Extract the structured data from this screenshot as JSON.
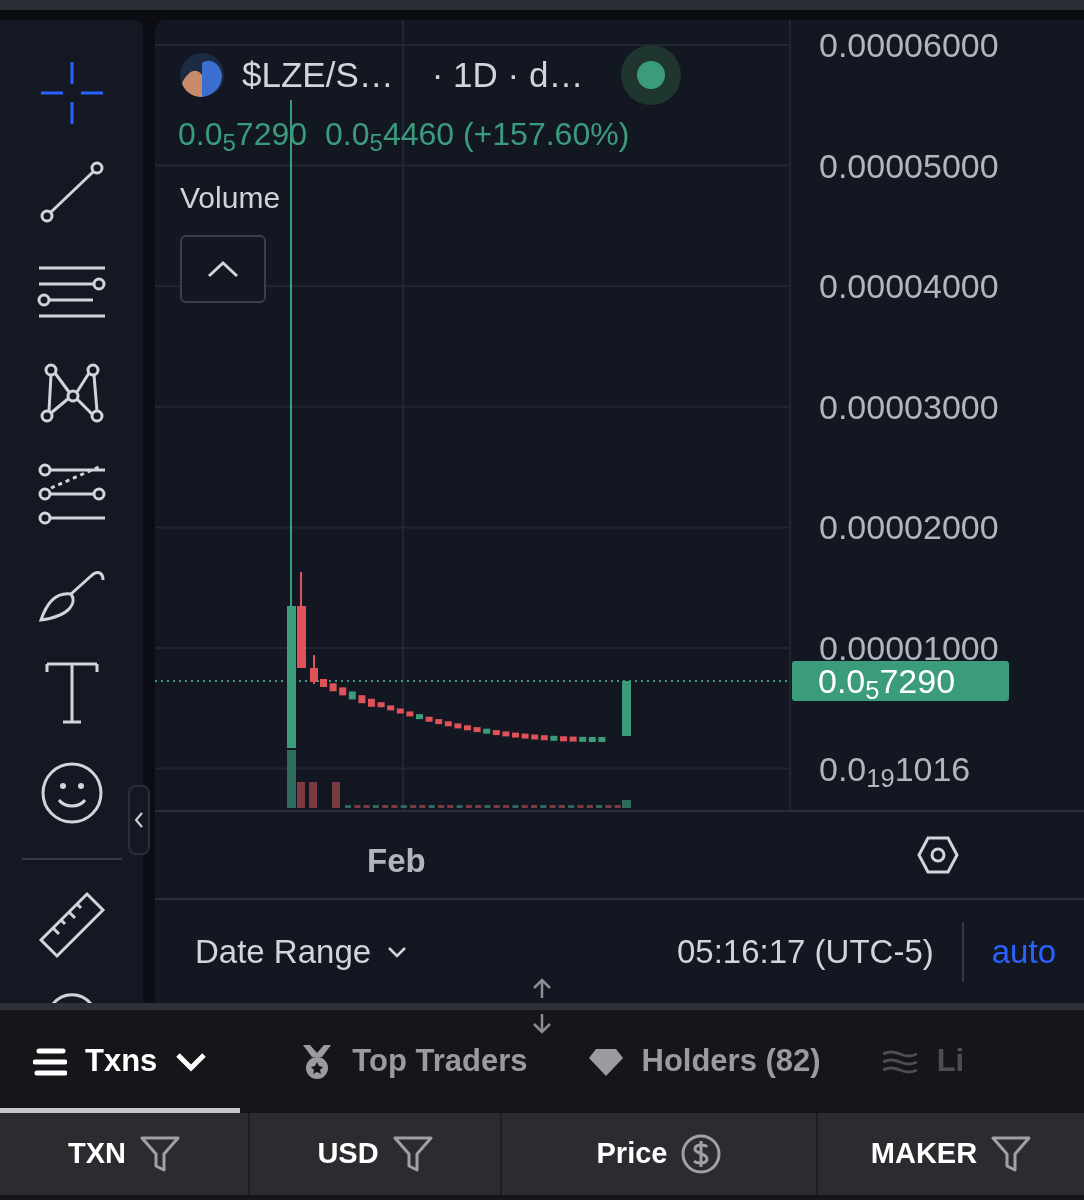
{
  "toolbar": {
    "tools": [
      {
        "kind": "crosshair",
        "selected": true
      },
      {
        "kind": "trend-line",
        "selected": false
      },
      {
        "kind": "parallel-lines",
        "selected": false
      },
      {
        "kind": "pattern",
        "selected": false
      },
      {
        "kind": "fib",
        "selected": false
      },
      {
        "kind": "brush",
        "selected": false
      },
      {
        "kind": "text",
        "selected": false
      },
      {
        "kind": "emoji",
        "selected": false
      },
      {
        "kind": "ruler",
        "selected": false
      },
      {
        "kind": "circle",
        "selected": false
      }
    ]
  },
  "chart": {
    "symbol": "$LZE/S…",
    "interval": "· 1D · d…",
    "last_price": "0.0$_{5}$7290",
    "change": "0.0$_{5}$4460 (+157.60%)",
    "indicator": "Volume",
    "price_axis": [
      "0.00006000",
      "0.00005000",
      "0.00004000",
      "0.00003000",
      "0.00002000",
      "0.00001000",
      "0.0$_{19}$1016"
    ],
    "current_price": "0.0$_{5}$7290",
    "time_axis": [
      "Feb"
    ]
  },
  "footer": {
    "date_range": "Date Range",
    "time": "05:16:17 (UTC-5)",
    "scale": "auto"
  },
  "tabs": [
    {
      "label": "Txns",
      "kind": "menu",
      "selected": true
    },
    {
      "label": "Top Traders",
      "kind": "medal",
      "selected": false
    },
    {
      "label": "Holders (82)",
      "kind": "diamond",
      "selected": false
    },
    {
      "label": "Li",
      "kind": "waves",
      "selected": false
    }
  ],
  "columns": [
    {
      "label": "TXN",
      "kind": "filter"
    },
    {
      "label": "USD",
      "kind": "filter"
    },
    {
      "label": "Price",
      "kind": "currency"
    },
    {
      "label": "MAKER",
      "kind": "filter"
    }
  ]
}
